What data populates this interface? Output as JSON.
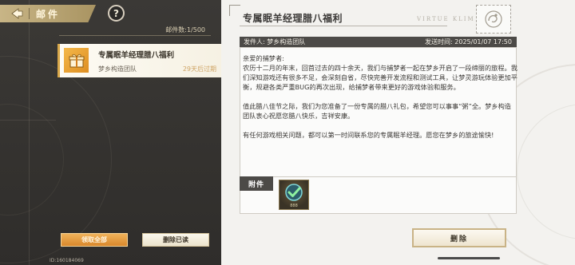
{
  "header": {
    "title": "邮件",
    "help_glyph": "?"
  },
  "mail_list": {
    "count_label": "邮件数:1/500",
    "items": [
      {
        "title": "专属眠羊经理腊八福利",
        "sender": "梦乡构造团队",
        "expire": "29天后过期"
      }
    ],
    "claim_all_label": "领取全部",
    "delete_read_label": "删除已读",
    "uid": "ID:160184069"
  },
  "detail": {
    "title": "专属眠羊经理腊八福利",
    "watermark": "VIRTUE KLIM",
    "sender_line": "发件人: 梦乡构造团队",
    "sent_line": "发送时间:   2025/01/07 17:50",
    "greeting": "亲爱的捕梦者:",
    "paragraph1": "农历十二月的年末，回首过去的四十余天，我们与捕梦者一起在梦乡开启了一段缔丽的旅程。我们深知游戏还有很多不足，会深刻自省，尽快完善开发流程和测试工具，让梦灵游玩体验更加平衡，规避各类严重BUG的再次出现，给捕梦者带来更好的游戏体验和服务。",
    "paragraph2": "值此腊八佳节之际，我们为您准备了一份专属的腊八礼包，希望您可以事事“粥”全。梦乡构造团队衷心祝愿您腊八快乐，吉祥安康。",
    "paragraph3": "有任何游戏相关问题，都可以第一时间联系您的专属眠羊经理。愿您在梦乡的旅途愉快!",
    "attachment_label": "附件",
    "attachment_qty": "888",
    "delete_label": "删除"
  },
  "colors": {
    "accent_gold": "#d9a84a",
    "claim_orange": "#e39a3b",
    "dark_bar": "#4c4a47"
  }
}
